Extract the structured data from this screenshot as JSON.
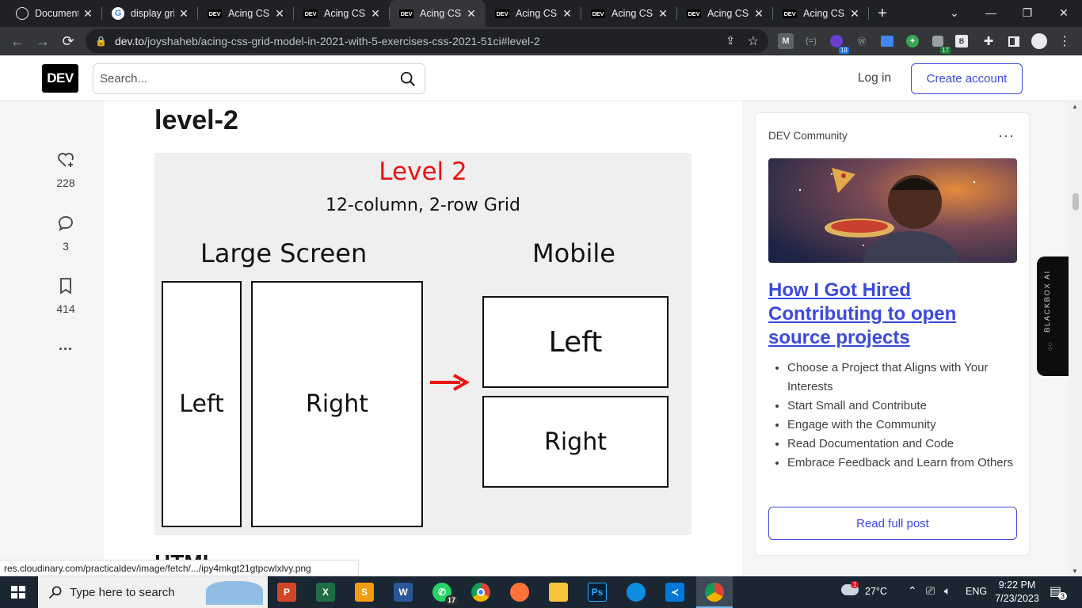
{
  "browser": {
    "tabs": [
      {
        "title": "Document",
        "favicon": "globe-icon",
        "active": false
      },
      {
        "title": "display grid",
        "favicon": "google-icon",
        "active": false
      },
      {
        "title": "Acing CSS",
        "favicon": "dev-icon",
        "active": false
      },
      {
        "title": "Acing CSS",
        "favicon": "dev-icon",
        "active": false
      },
      {
        "title": "Acing CSS",
        "favicon": "dev-icon",
        "active": true
      },
      {
        "title": "Acing CSS",
        "favicon": "dev-icon",
        "active": false
      },
      {
        "title": "Acing CSS",
        "favicon": "dev-icon",
        "active": false
      },
      {
        "title": "Acing CSS",
        "favicon": "dev-icon",
        "active": false
      },
      {
        "title": "Acing CSS",
        "favicon": "dev-icon",
        "active": false
      }
    ],
    "url_host": "dev.to",
    "url_path": "/joyshaheb/acing-css-grid-model-in-2021-with-5-exercises-css-2021-51ci#level-2",
    "ext_badges": {
      "purple": "18",
      "green": "17"
    },
    "status_url": "res.cloudinary.com/practicaldev/image/fetch/.../ipy4mkgt21gtpcwlxlvy.png"
  },
  "header": {
    "logo": "DEV",
    "search_placeholder": "Search...",
    "login": "Log in",
    "create_account": "Create account"
  },
  "reactions": {
    "likes": "228",
    "comments": "3",
    "bookmarks": "414",
    "more": "..."
  },
  "article": {
    "heading": "level-2",
    "next_heading": "HTML",
    "figure": {
      "title": "Level 2",
      "subtitle": "12-column, 2-row Grid",
      "large_label": "Large Screen",
      "mobile_label": "Mobile",
      "large_left": "Left",
      "large_right": "Right",
      "mobile_left": "Left",
      "mobile_right": "Right",
      "title_color": "#ee1111",
      "arrow_color": "#ee1111"
    }
  },
  "sidebar": {
    "source": "DEV Community",
    "post_title": "How I Got Hired Contributing to open source projects",
    "bullets": [
      "Choose a Project that Aligns with Your Interests",
      "Start Small and Contribute",
      "Engage with the Community",
      "Read Documentation and Code",
      "Embrace Feedback and Learn from Others"
    ],
    "read_button": "Read full post",
    "accent": "#3b49df"
  },
  "blackbox": {
    "label": "BLACKBOX AI"
  },
  "taskbar": {
    "search_placeholder": "Type here to search",
    "whatsapp_badge": "17",
    "weather": "27°C",
    "weather_badge": "1",
    "language": "ENG",
    "time": "9:22 PM",
    "date": "7/23/2023",
    "notifications": "3"
  }
}
